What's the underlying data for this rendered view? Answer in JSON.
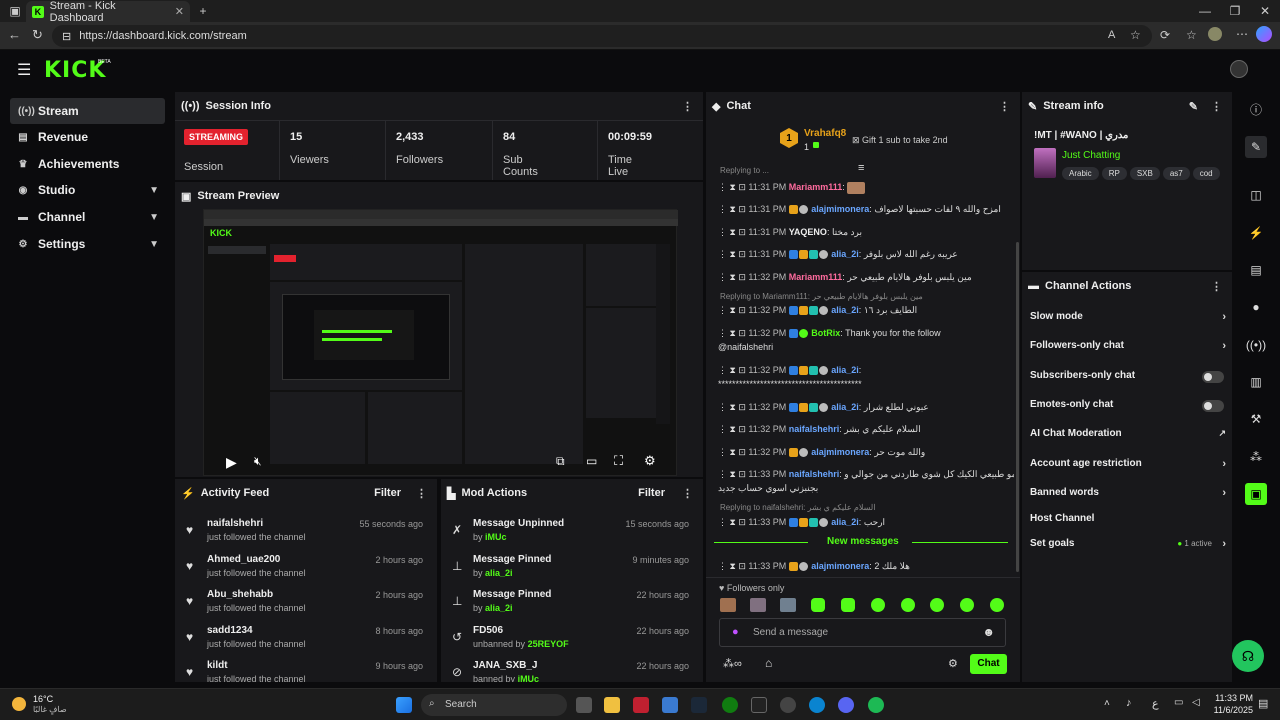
{
  "browser": {
    "tab_title": "Stream - Kick Dashboard",
    "url": "https://dashboard.kick.com/stream"
  },
  "app": {
    "logo": "KICK",
    "beta": "BETA"
  },
  "sidebar": {
    "items": [
      {
        "label": "Stream",
        "icon": "broadcast-icon"
      },
      {
        "label": "Revenue",
        "icon": "chart-icon"
      },
      {
        "label": "Achievements",
        "icon": "trophy-icon"
      },
      {
        "label": "Studio",
        "icon": "studio-icon"
      },
      {
        "label": "Channel",
        "icon": "channel-icon"
      },
      {
        "label": "Settings",
        "icon": "gear-icon"
      }
    ]
  },
  "session": {
    "title": "Session Info",
    "badge": "STREAMING",
    "badge_label": "Session",
    "stats": [
      {
        "value": "15",
        "label": "Viewers"
      },
      {
        "value": "2,433",
        "label": "Followers"
      },
      {
        "value": "84",
        "label": "Sub Counts"
      },
      {
        "value": "00:09:59",
        "label": "Time Live"
      }
    ]
  },
  "preview": {
    "title": "Stream Preview"
  },
  "activity": {
    "title": "Activity Feed",
    "filter": "Filter",
    "items": [
      {
        "name": "naifalshehri",
        "sub": "just followed the channel",
        "time": "55 seconds ago"
      },
      {
        "name": "Ahmed_uae200",
        "sub": "just followed the channel",
        "time": "2 hours ago"
      },
      {
        "name": "Abu_shehabb",
        "sub": "just followed the channel",
        "time": "2 hours ago"
      },
      {
        "name": "sadd1234",
        "sub": "just followed the channel",
        "time": "8 hours ago"
      },
      {
        "name": "kildt",
        "sub": "just followed the channel",
        "time": "9 hours ago"
      }
    ]
  },
  "mod": {
    "title": "Mod Actions",
    "filter": "Filter",
    "items": [
      {
        "name": "Message Unpinned",
        "by": "by",
        "user": "iMUc",
        "time": "15 seconds ago"
      },
      {
        "name": "Message Pinned",
        "by": "by",
        "user": "alia_2i",
        "time": "9 minutes ago"
      },
      {
        "name": "Message Pinned",
        "by": "by",
        "user": "alia_2i",
        "time": "22 hours ago"
      },
      {
        "name": "FD506",
        "by": "unbanned by",
        "user": "25REYOF",
        "time": "22 hours ago"
      },
      {
        "name": "JANA_SXB_J",
        "by": "banned by",
        "user": "iMUc",
        "time": "22 hours ago"
      }
    ]
  },
  "chat": {
    "title": "Chat",
    "gifter": "Vrahafq8",
    "gifter_count": "1",
    "gifter_rank": "1",
    "gift_cta": "Gift 1 sub to take 2nd",
    "messages": [
      {
        "time": "11:31 PM",
        "user": "Mariamm111",
        "color": "#ff6b9e",
        "text": ""
      },
      {
        "time": "11:31 PM",
        "user": "alajmimonera",
        "color": "#6aa6ff",
        "text": "امزح والله ٩ لفات حسبتها لاصواف"
      },
      {
        "time": "11:31 PM",
        "user": "YAQENO",
        "color": "#eeeeee",
        "text": "برد مختا"
      },
      {
        "time": "11:31 PM",
        "user": "alia_2i",
        "color": "#6aa6ff",
        "text": "عريبه رغم الله لاس بلوفر"
      },
      {
        "time": "11:32 PM",
        "user": "Mariamm111",
        "color": "#ff6b9e",
        "text": "مين يلبس بلوفر هالايام طبيعي حر"
      },
      {
        "time": "11:32 PM",
        "user": "alia_2i",
        "color": "#6aa6ff",
        "text": "الطايف برد ١٦"
      },
      {
        "time": "11:32 PM",
        "user": "BotRix",
        "color": "#53fc18",
        "text": "Thank you for the follow"
      },
      {
        "time": "11:32 PM",
        "user": "alia_2i",
        "color": "#6aa6ff",
        "text": ""
      },
      {
        "time": "11:32 PM",
        "user": "alia_2i",
        "color": "#6aa6ff",
        "text": "عبوني لطلع شرار"
      },
      {
        "time": "11:32 PM",
        "user": "naifalshehri",
        "color": "#6aa6ff",
        "text": "السلام عليكم ي بشر"
      },
      {
        "time": "11:32 PM",
        "user": "alajmimonera",
        "color": "#6aa6ff",
        "text": "والله موت حر"
      },
      {
        "time": "11:33 PM",
        "user": "naifalshehri",
        "color": "#6aa6ff",
        "text": "مو طبيعي الكيك كل شوي طاردني من جوالي و"
      },
      {
        "time": "11:33 PM",
        "user": "alia_2i",
        "color": "#6aa6ff",
        "text": "ارحب"
      },
      {
        "time": "11:33 PM",
        "user": "alajmimonera",
        "color": "#6aa6ff",
        "text": "هلا ملك 2"
      }
    ],
    "mention": "@naifalshehri",
    "stars": "*****************************************",
    "wrap_line": "بجنبزني اسوي حساب جديد",
    "reply1": "Replying to Mariamm111: مين يلبس بلوفر هالايام طبيعي حر",
    "reply2": "Replying to naifalshehri: السلام عليكم ي بشر",
    "reply0": "Replying to ...",
    "new_messages": "New messages",
    "followers_only": "Followers only",
    "placeholder": "Send a message",
    "send": "Chat"
  },
  "stream_info": {
    "title": "Stream info",
    "stream_title": "!MT | #WANO | مدري",
    "category": "Just Chatting",
    "tags": [
      "Arabic",
      "RP",
      "SXB",
      "as7",
      "cod"
    ]
  },
  "channel_actions": {
    "title": "Channel Actions",
    "items": [
      {
        "label": "Slow mode",
        "kind": "chevron"
      },
      {
        "label": "Followers-only chat",
        "kind": "chevron"
      },
      {
        "label": "Subscribers-only chat",
        "kind": "toggle"
      },
      {
        "label": "Emotes-only chat",
        "kind": "toggle"
      },
      {
        "label": "AI Chat Moderation",
        "kind": "external"
      },
      {
        "label": "Account age restriction",
        "kind": "chevron"
      },
      {
        "label": "Banned words",
        "kind": "chevron"
      },
      {
        "label": "Host Channel",
        "kind": "none"
      },
      {
        "label": "Set goals",
        "kind": "chevron"
      }
    ],
    "goals_status": "1 active"
  },
  "taskbar": {
    "weather_temp": "16°C",
    "weather_desc": "صافٍ غالبًا",
    "search": "Search",
    "time": "11:33 PM",
    "date": "11/6/2025",
    "lang": "ع"
  },
  "colors": {
    "accent": "#53fc18",
    "live": "#e3222e"
  }
}
